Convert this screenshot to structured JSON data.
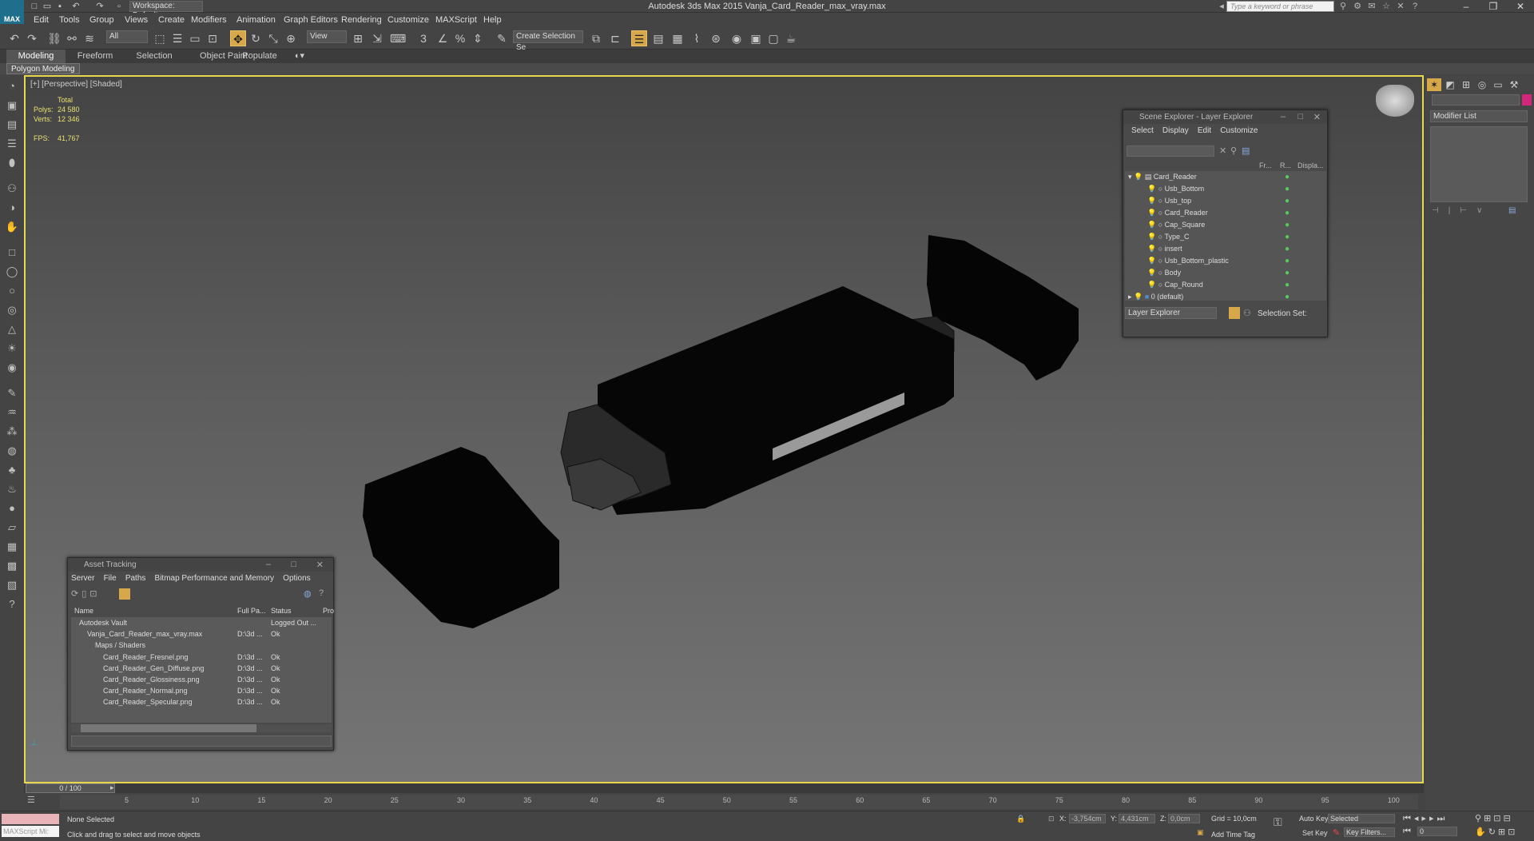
{
  "titlebar": {
    "app_title": "Autodesk 3ds Max  2015      Vanja_Card_Reader_max_vray.max",
    "workspace": "Workspace: Default",
    "search_placeholder": "Type a keyword or phrase",
    "logo": "MAX"
  },
  "menus": [
    "Edit",
    "Tools",
    "Group",
    "Views",
    "Create",
    "Modifiers",
    "Animation",
    "Graph Editors",
    "Rendering",
    "Customize",
    "MAXScript",
    "Help"
  ],
  "toolbar": {
    "selection_filter": "All",
    "ref_coord": "View",
    "named_selection": "Create Selection Se"
  },
  "ribbon": {
    "tabs": [
      "Modeling",
      "Freeform",
      "Selection",
      "Object Paint",
      "Populate"
    ],
    "active_tab": "Modeling",
    "panel_label": "Polygon Modeling"
  },
  "viewport": {
    "label": "[+] [Perspective] [Shaded]",
    "stats_header": "Total",
    "polys_label": "Polys:",
    "polys_value": "24 580",
    "verts_label": "Verts:",
    "verts_value": "12 346",
    "fps_label": "FPS:",
    "fps_value": "41,767"
  },
  "scene_explorer": {
    "title": "Scene Explorer - Layer Explorer",
    "menus": [
      "Select",
      "Display",
      "Edit",
      "Customize"
    ],
    "columns": [
      "Fr...",
      "R...",
      "Displa..."
    ],
    "root_layer": "Card_Reader",
    "children": [
      "Usb_Bottom",
      "Usb_top",
      "Card_Reader",
      "Cap_Square",
      "Type_C",
      "insert",
      "Usb_Bottom_plastic",
      "Body",
      "Cap_Round"
    ],
    "default_layer": "0 (default)",
    "footer_combo": "Layer Explorer",
    "selection_set_label": "Selection Set:"
  },
  "asset_tracking": {
    "title": "Asset Tracking",
    "menus": [
      "Server",
      "File",
      "Paths",
      "Bitmap Performance and Memory",
      "Options"
    ],
    "columns": [
      "Name",
      "Full Pa...",
      "Status",
      "Pro"
    ],
    "rows": [
      {
        "name": "Autodesk Vault",
        "path": "",
        "status": "Logged Out ...",
        "indent": 1
      },
      {
        "name": "Vanja_Card_Reader_max_vray.max",
        "path": "D:\\3d ...",
        "status": "Ok",
        "indent": 2
      },
      {
        "name": "Maps / Shaders",
        "path": "",
        "status": "",
        "indent": 3
      },
      {
        "name": "Card_Reader_Fresnel.png",
        "path": "D:\\3d ...",
        "status": "Ok",
        "indent": 4
      },
      {
        "name": "Card_Reader_Gen_Diffuse.png",
        "path": "D:\\3d ...",
        "status": "Ok",
        "indent": 4
      },
      {
        "name": "Card_Reader_Glossiness.png",
        "path": "D:\\3d ...",
        "status": "Ok",
        "indent": 4
      },
      {
        "name": "Card_Reader_Normal.png",
        "path": "D:\\3d ...",
        "status": "Ok",
        "indent": 4
      },
      {
        "name": "Card_Reader_Specular.png",
        "path": "D:\\3d ...",
        "status": "Ok",
        "indent": 4
      }
    ]
  },
  "command_panel": {
    "modifier_list": "Modifier List"
  },
  "timeline": {
    "slider": "0 / 100",
    "ticks": [
      "5",
      "10",
      "15",
      "20",
      "25",
      "30",
      "35",
      "40",
      "45",
      "50",
      "55",
      "60",
      "65",
      "70",
      "75",
      "80",
      "85",
      "90",
      "95",
      "100"
    ]
  },
  "status": {
    "maxscript": "MAXScript Mi:",
    "selection": "None Selected",
    "prompt": "Click and drag to select and move objects",
    "x_label": "X:",
    "x_value": "-3,754cm",
    "y_label": "Y:",
    "y_value": "4,431cm",
    "z_label": "Z:",
    "z_value": "0,0cm",
    "grid": "Grid = 10,0cm",
    "add_time_tag": "Add Time Tag",
    "auto_key": "Auto Key",
    "set_key": "Set Key",
    "key_mode": "Selected",
    "key_filters": "Key Filters...",
    "frame": "0"
  }
}
